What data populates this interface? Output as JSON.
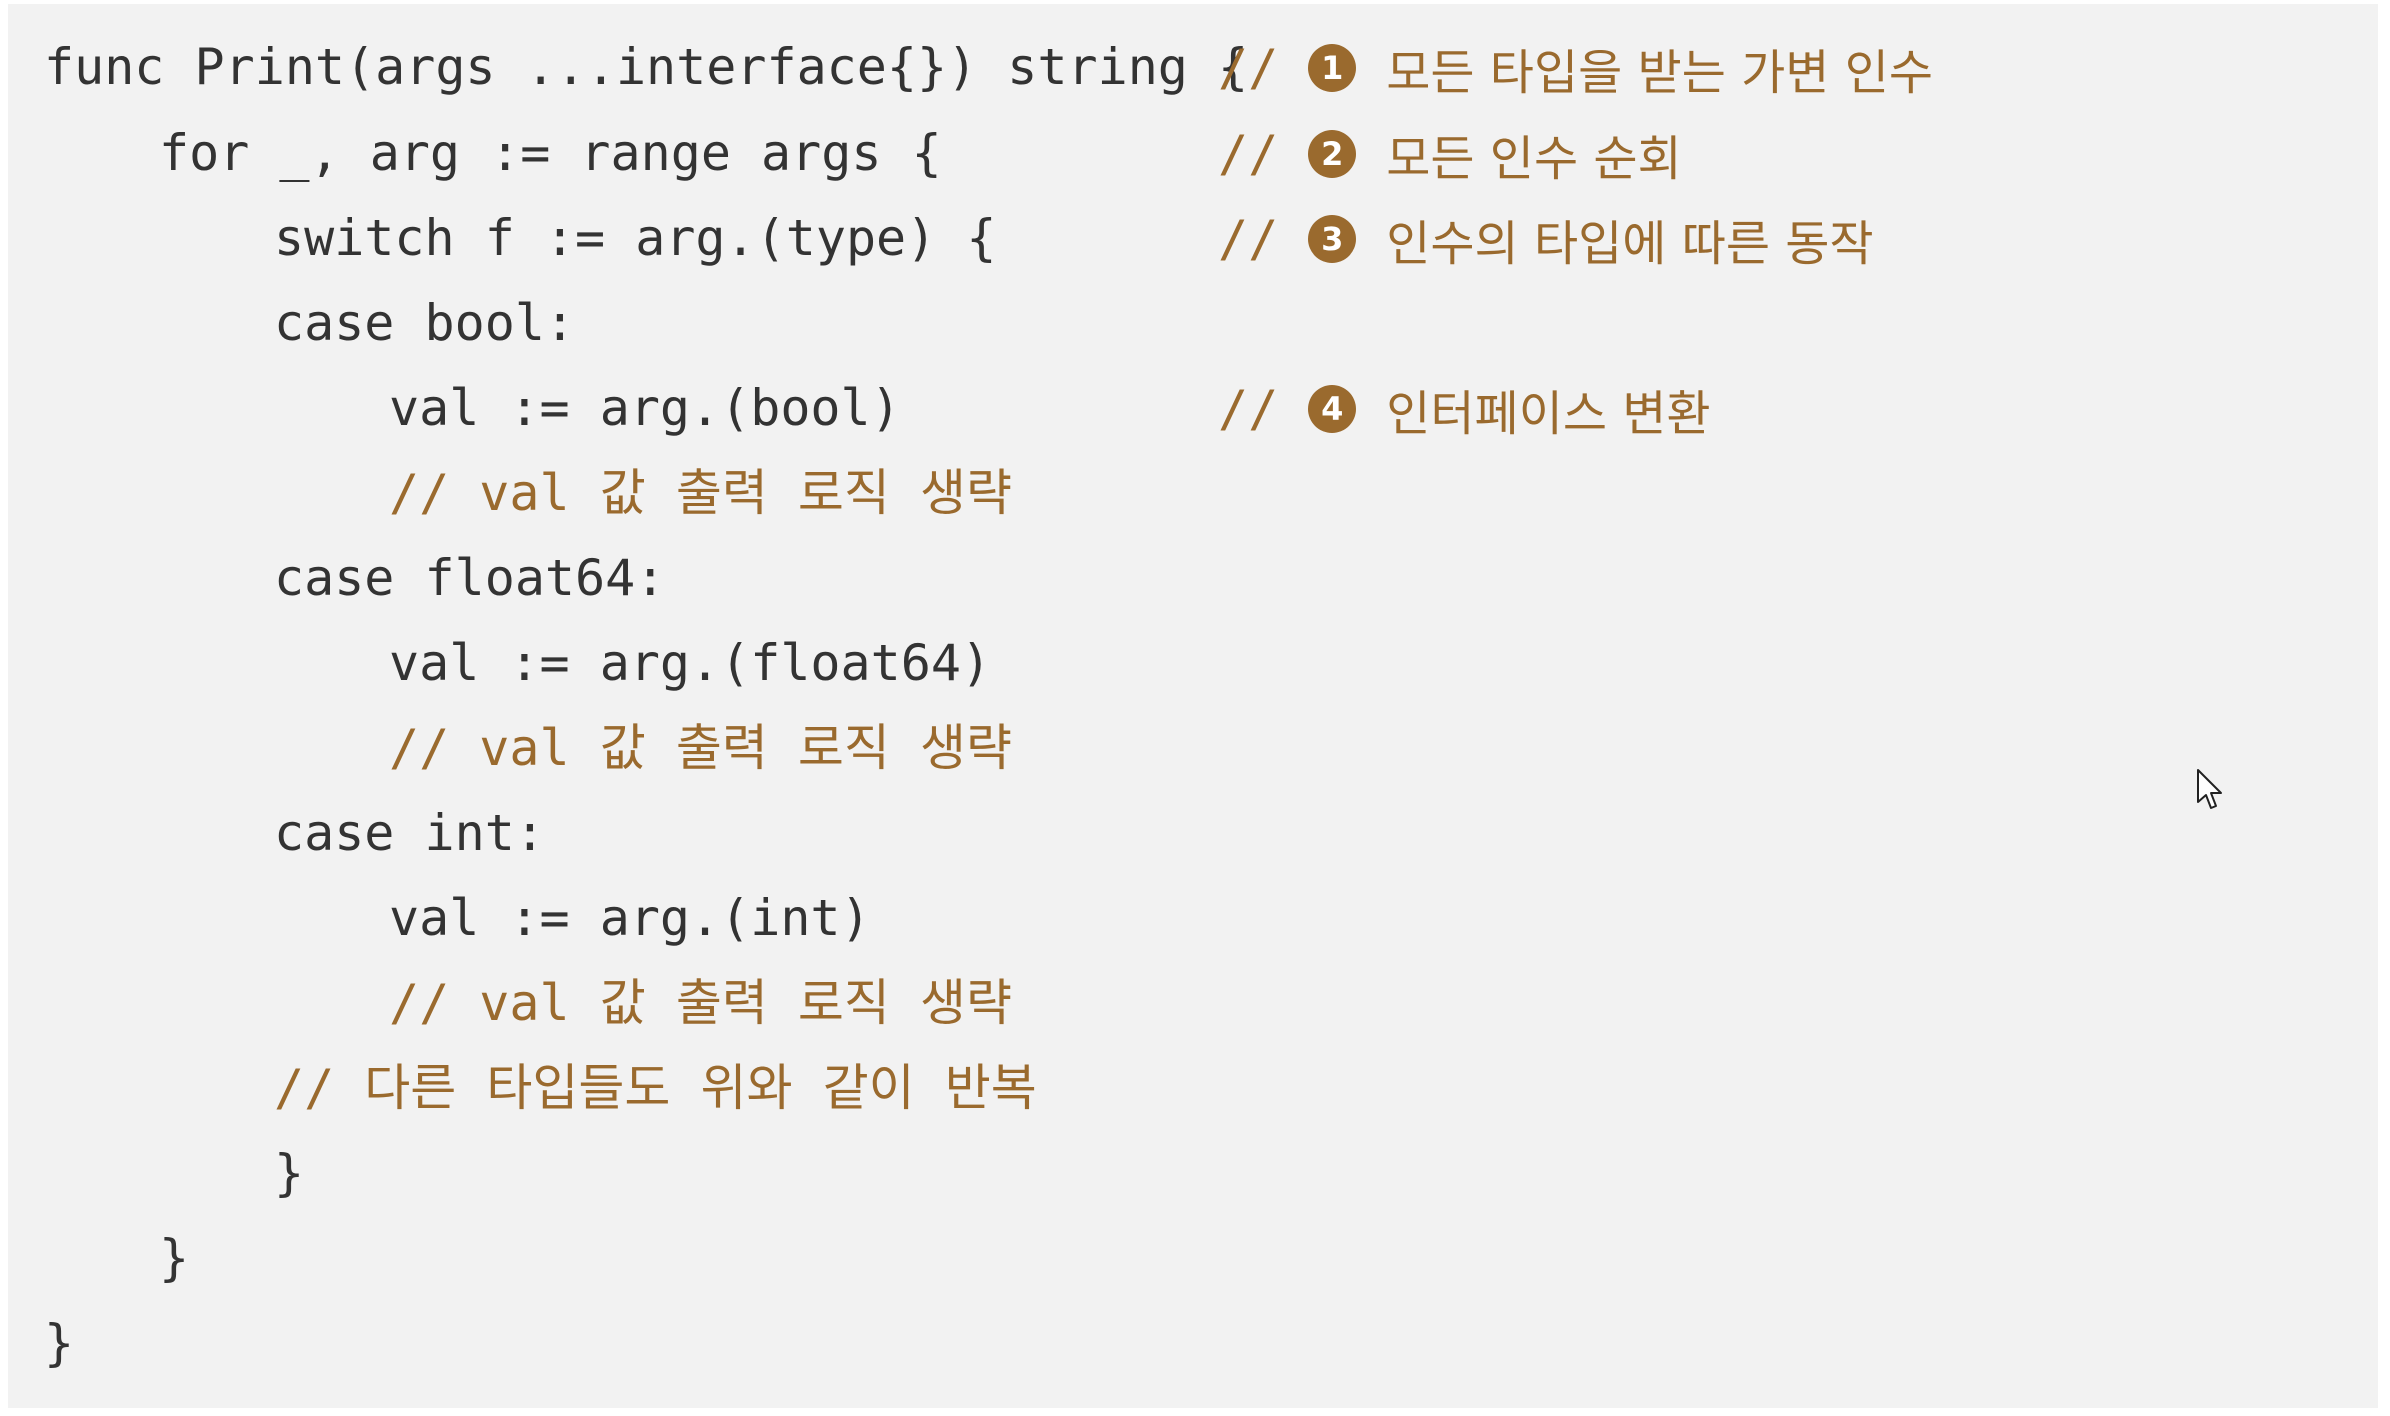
{
  "code": {
    "lines": [
      {
        "code": "func Print(args ...interface{}) string {",
        "comment": "",
        "annotation": {
          "slashes": "//",
          "number": "1",
          "text": "모든 타입을 받는 가변 인수"
        }
      },
      {
        "code": "for _, arg := range args {",
        "comment": "",
        "annotation": {
          "slashes": "//",
          "number": "2",
          "text": "모든 인수 순회"
        }
      },
      {
        "code": "switch f := arg.(type) {",
        "comment": "",
        "annotation": {
          "slashes": "//",
          "number": "3",
          "text": "인수의 타입에 따른 동작"
        }
      },
      {
        "code": "case bool:",
        "comment": "",
        "annotation": null
      },
      {
        "code": "val := arg.(bool)",
        "comment": "",
        "annotation": {
          "slashes": "//",
          "number": "4",
          "text": "인터페이스 변환"
        }
      },
      {
        "code": "",
        "comment": "// val 값 출력 로직 생략",
        "annotation": null
      },
      {
        "code": "case float64:",
        "comment": "",
        "annotation": null
      },
      {
        "code": "val := arg.(float64)",
        "comment": "",
        "annotation": null
      },
      {
        "code": "",
        "comment": "// val 값 출력 로직 생략",
        "annotation": null
      },
      {
        "code": "case int:",
        "comment": "",
        "annotation": null
      },
      {
        "code": "val := arg.(int)",
        "comment": "",
        "annotation": null
      },
      {
        "code": "",
        "comment": "// val 값 출력 로직 생략",
        "annotation": null
      },
      {
        "code": "",
        "comment": "// 다른 타입들도 위와 같이 반복",
        "annotation": null
      },
      {
        "code": "}",
        "comment": "",
        "annotation": null
      },
      {
        "code": "}",
        "comment": "",
        "annotation": null
      },
      {
        "code": "}",
        "comment": "",
        "annotation": null
      }
    ]
  },
  "colors": {
    "background": "#f2f2f2",
    "code_text": "#333333",
    "comment": "#9a6a2e"
  }
}
